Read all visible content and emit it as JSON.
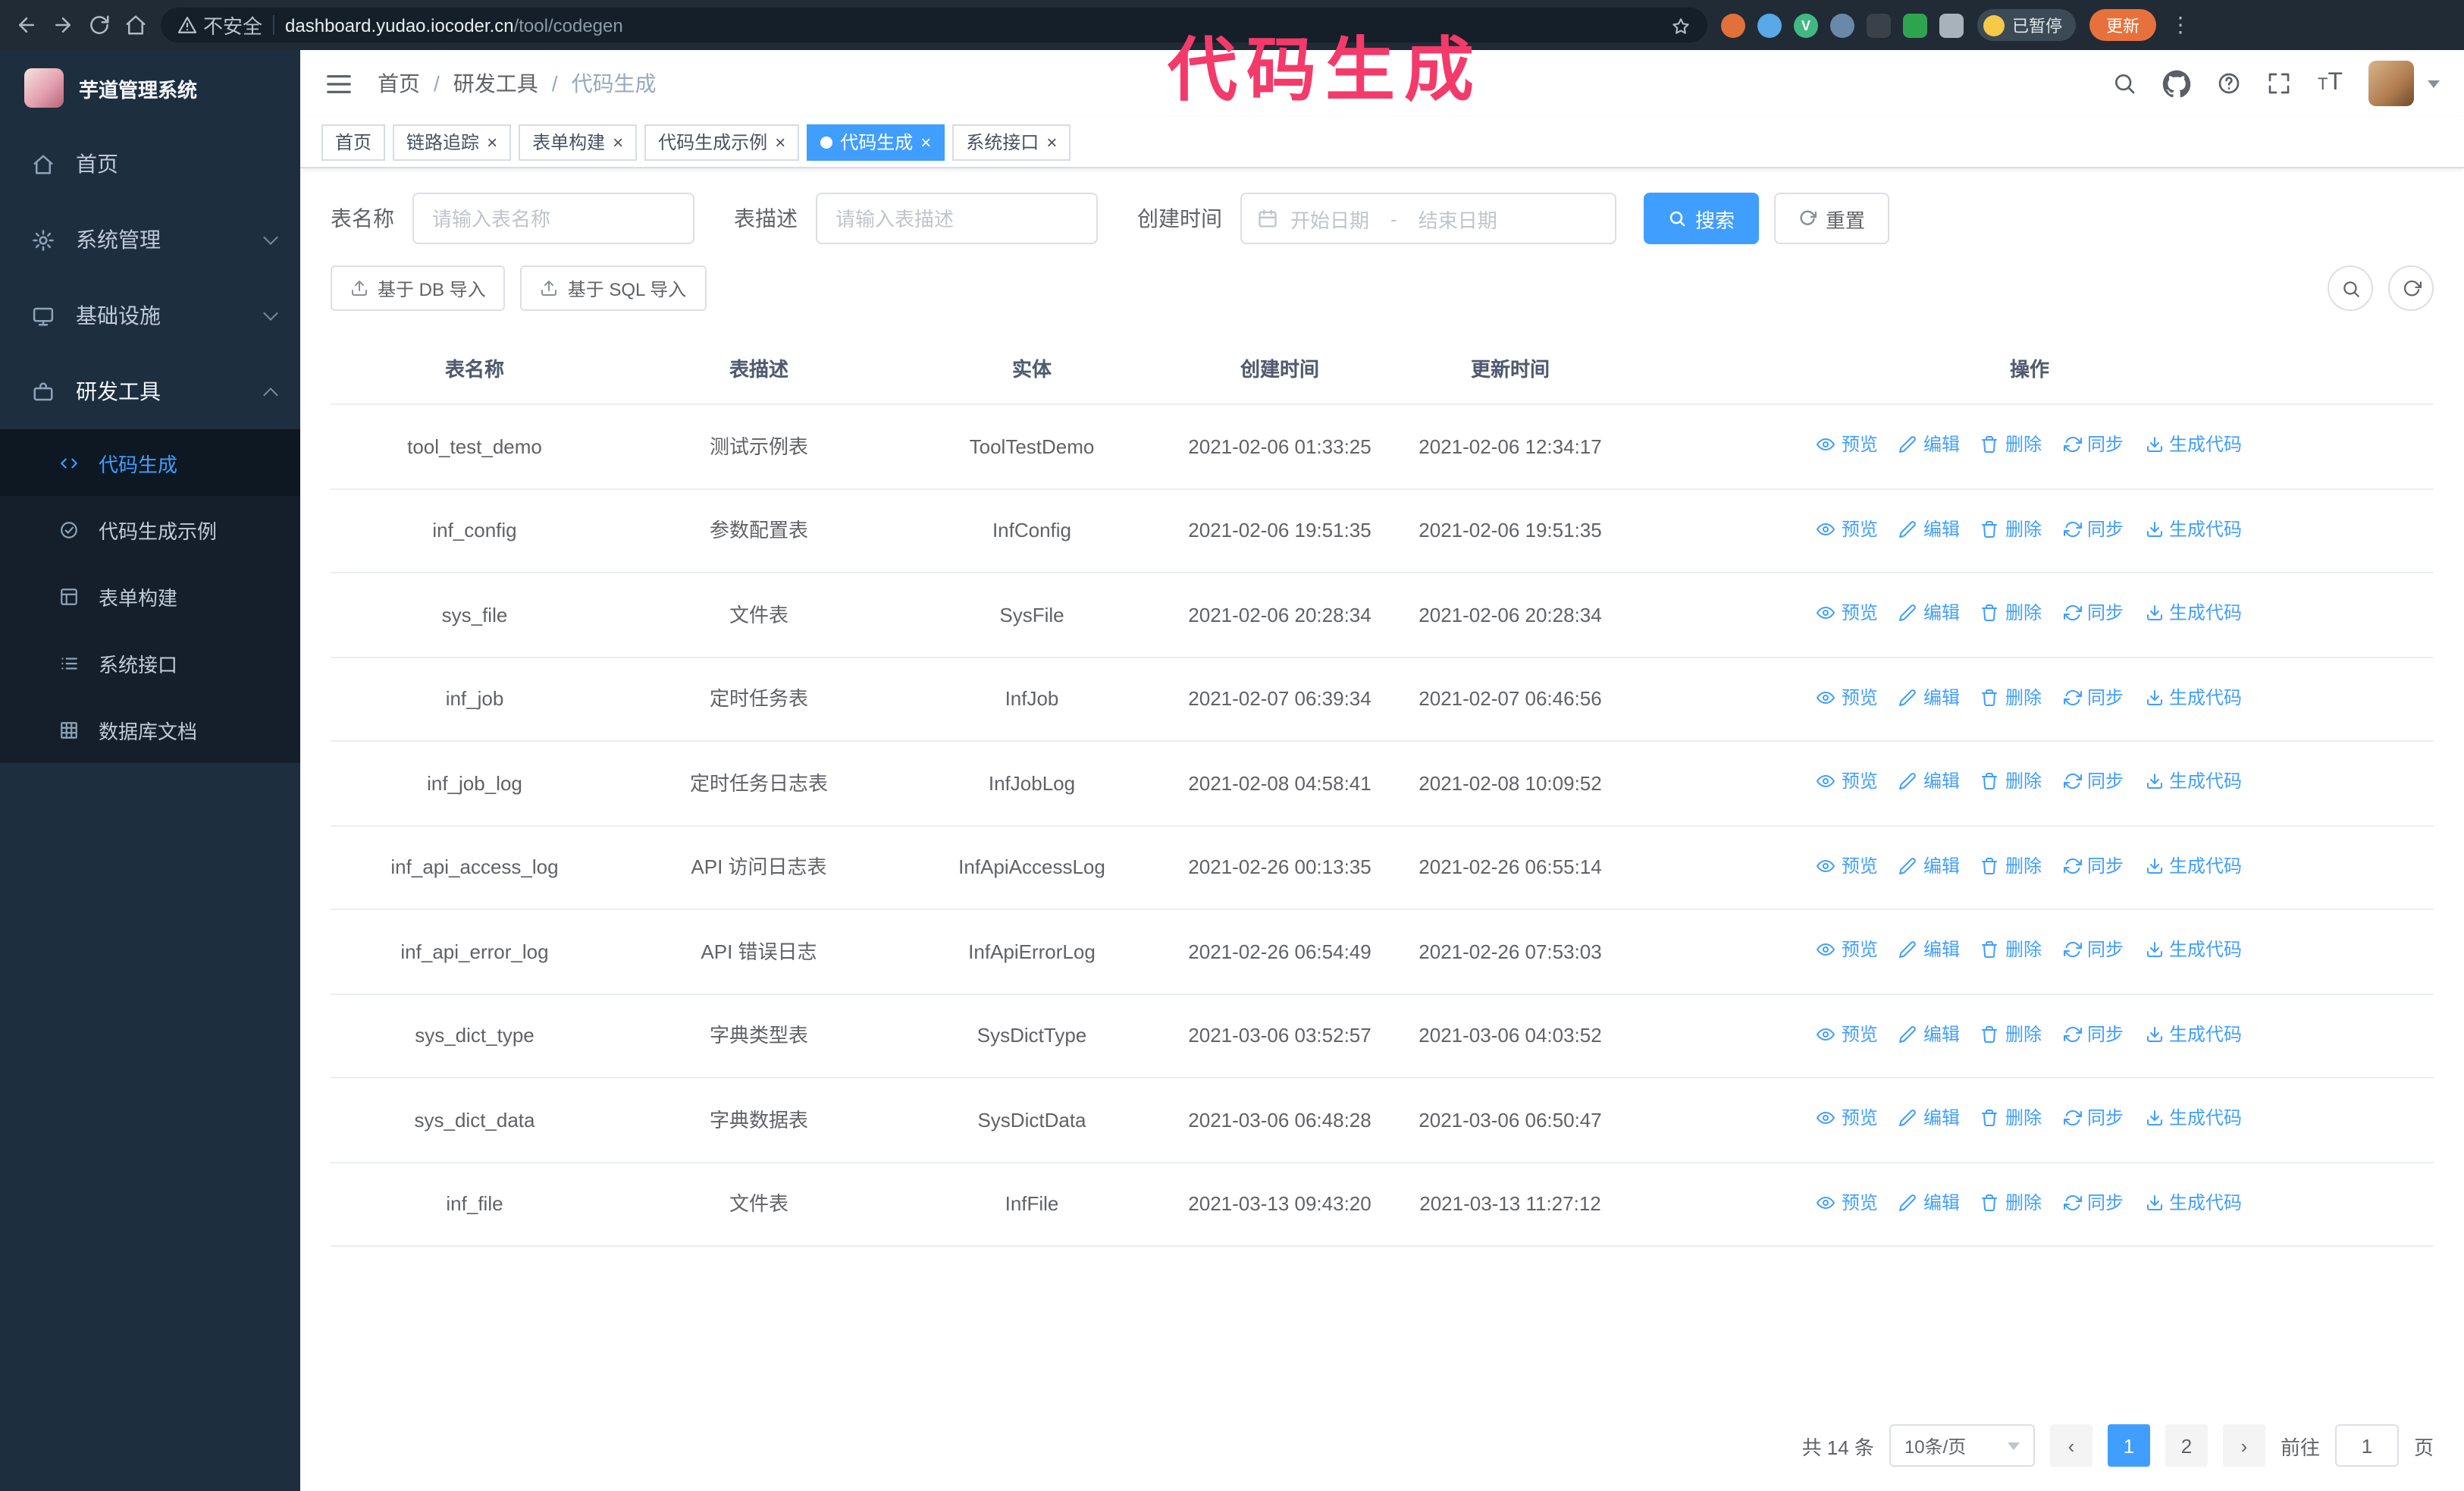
{
  "colors": {
    "accent": "#409eff",
    "annotation": "#f43a6a",
    "sidebar_bg": "#1d2e3f",
    "submenu_bg": "#141f2b",
    "link": "#409eff"
  },
  "annotation": {
    "text": "代码生成"
  },
  "browser": {
    "nav_icons": [
      "back-icon",
      "forward-icon",
      "reload-icon",
      "home-icon"
    ],
    "security_label": "不安全",
    "url_host": "dashboard.yudao.iocoder.cn",
    "url_path": "/tool/codegen",
    "bookmark_icon": "star-icon",
    "extension_icons": [
      "extension-icon-1",
      "extension-icon-2",
      "vue-devtools-icon",
      "extension-icon-4",
      "extension-icon-5",
      "extension-icon-6",
      "puzzle-icon"
    ],
    "paused_badge": "已暂停",
    "update_button": "更新"
  },
  "sidebar": {
    "logo_title": "芋道管理系统",
    "items": [
      {
        "label": "首页",
        "icon": "home-icon",
        "expandable": false
      },
      {
        "label": "系统管理",
        "icon": "gear-icon",
        "expandable": true
      },
      {
        "label": "基础设施",
        "icon": "monitor-icon",
        "expandable": true
      },
      {
        "label": "研发工具",
        "icon": "toolbox-icon",
        "expandable": true,
        "expanded": true
      }
    ],
    "submenu": [
      {
        "label": "代码生成",
        "icon": "code-icon",
        "active": true
      },
      {
        "label": "代码生成示例",
        "icon": "circle-check-icon",
        "active": false
      },
      {
        "label": "表单构建",
        "icon": "form-icon",
        "active": false
      },
      {
        "label": "系统接口",
        "icon": "list-icon",
        "active": false
      },
      {
        "label": "数据库文档",
        "icon": "grid-icon",
        "active": false
      }
    ]
  },
  "header": {
    "breadcrumb": [
      "首页",
      "研发工具",
      "代码生成"
    ],
    "separator": "/",
    "right_icons": [
      "search-icon",
      "github-icon",
      "help-icon",
      "fullscreen-icon",
      "font-size-icon",
      "avatar",
      "caret-down-icon"
    ]
  },
  "tabs": [
    {
      "label": "首页",
      "closable": false,
      "active": false
    },
    {
      "label": "链路追踪",
      "closable": true,
      "active": false
    },
    {
      "label": "表单构建",
      "closable": true,
      "active": false
    },
    {
      "label": "代码生成示例",
      "closable": true,
      "active": false
    },
    {
      "label": "代码生成",
      "closable": true,
      "active": true
    },
    {
      "label": "系统接口",
      "closable": true,
      "active": false
    }
  ],
  "filters": {
    "table_name_label": "表名称",
    "table_name_placeholder": "请输入表名称",
    "table_desc_label": "表描述",
    "table_desc_placeholder": "请输入表描述",
    "create_time_label": "创建时间",
    "date_start_placeholder": "开始日期",
    "date_separator": "-",
    "date_end_placeholder": "结束日期",
    "search_button": "搜索",
    "reset_button": "重置"
  },
  "toolbar": {
    "import_db_button": "基于 DB 导入",
    "import_sql_button": "基于 SQL 导入",
    "right_icons": [
      "search-toggle-icon",
      "refresh-icon"
    ]
  },
  "table": {
    "headers": [
      "表名称",
      "表描述",
      "实体",
      "创建时间",
      "更新时间",
      "操作"
    ],
    "actions": [
      {
        "name": "preview",
        "label": "预览",
        "icon": "eye-icon"
      },
      {
        "name": "edit",
        "label": "编辑",
        "icon": "edit-icon"
      },
      {
        "name": "delete",
        "label": "删除",
        "icon": "trash-icon"
      },
      {
        "name": "sync",
        "label": "同步",
        "icon": "sync-icon"
      },
      {
        "name": "generate-code",
        "label": "生成代码",
        "icon": "download-icon"
      }
    ],
    "rows": [
      {
        "name": "tool_test_demo",
        "desc": "测试示例表",
        "entity": "ToolTestDemo",
        "created": "2021-02-06 01:33:25",
        "updated": "2021-02-06 12:34:17"
      },
      {
        "name": "inf_config",
        "desc": "参数配置表",
        "entity": "InfConfig",
        "created": "2021-02-06 19:51:35",
        "updated": "2021-02-06 19:51:35"
      },
      {
        "name": "sys_file",
        "desc": "文件表",
        "entity": "SysFile",
        "created": "2021-02-06 20:28:34",
        "updated": "2021-02-06 20:28:34"
      },
      {
        "name": "inf_job",
        "desc": "定时任务表",
        "entity": "InfJob",
        "created": "2021-02-07 06:39:34",
        "updated": "2021-02-07 06:46:56"
      },
      {
        "name": "inf_job_log",
        "desc": "定时任务日志表",
        "entity": "InfJobLog",
        "created": "2021-02-08 04:58:41",
        "updated": "2021-02-08 10:09:52"
      },
      {
        "name": "inf_api_access_log",
        "desc": "API 访问日志表",
        "entity": "InfApiAccessLog",
        "created": "2021-02-26 00:13:35",
        "updated": "2021-02-26 06:55:14"
      },
      {
        "name": "inf_api_error_log",
        "desc": "API 错误日志",
        "entity": "InfApiErrorLog",
        "created": "2021-02-26 06:54:49",
        "updated": "2021-02-26 07:53:03"
      },
      {
        "name": "sys_dict_type",
        "desc": "字典类型表",
        "entity": "SysDictType",
        "created": "2021-03-06 03:52:57",
        "updated": "2021-03-06 04:03:52"
      },
      {
        "name": "sys_dict_data",
        "desc": "字典数据表",
        "entity": "SysDictData",
        "created": "2021-03-06 06:48:28",
        "updated": "2021-03-06 06:50:47"
      },
      {
        "name": "inf_file",
        "desc": "文件表",
        "entity": "InfFile",
        "created": "2021-03-13 09:43:20",
        "updated": "2021-03-13 11:27:12"
      }
    ]
  },
  "pagination": {
    "total": "共 14 条",
    "page_size": "10条/页",
    "pages": [
      "1",
      "2"
    ],
    "current_page": "1",
    "goto_label": "前往",
    "goto_value": "1",
    "page_unit": "页"
  }
}
